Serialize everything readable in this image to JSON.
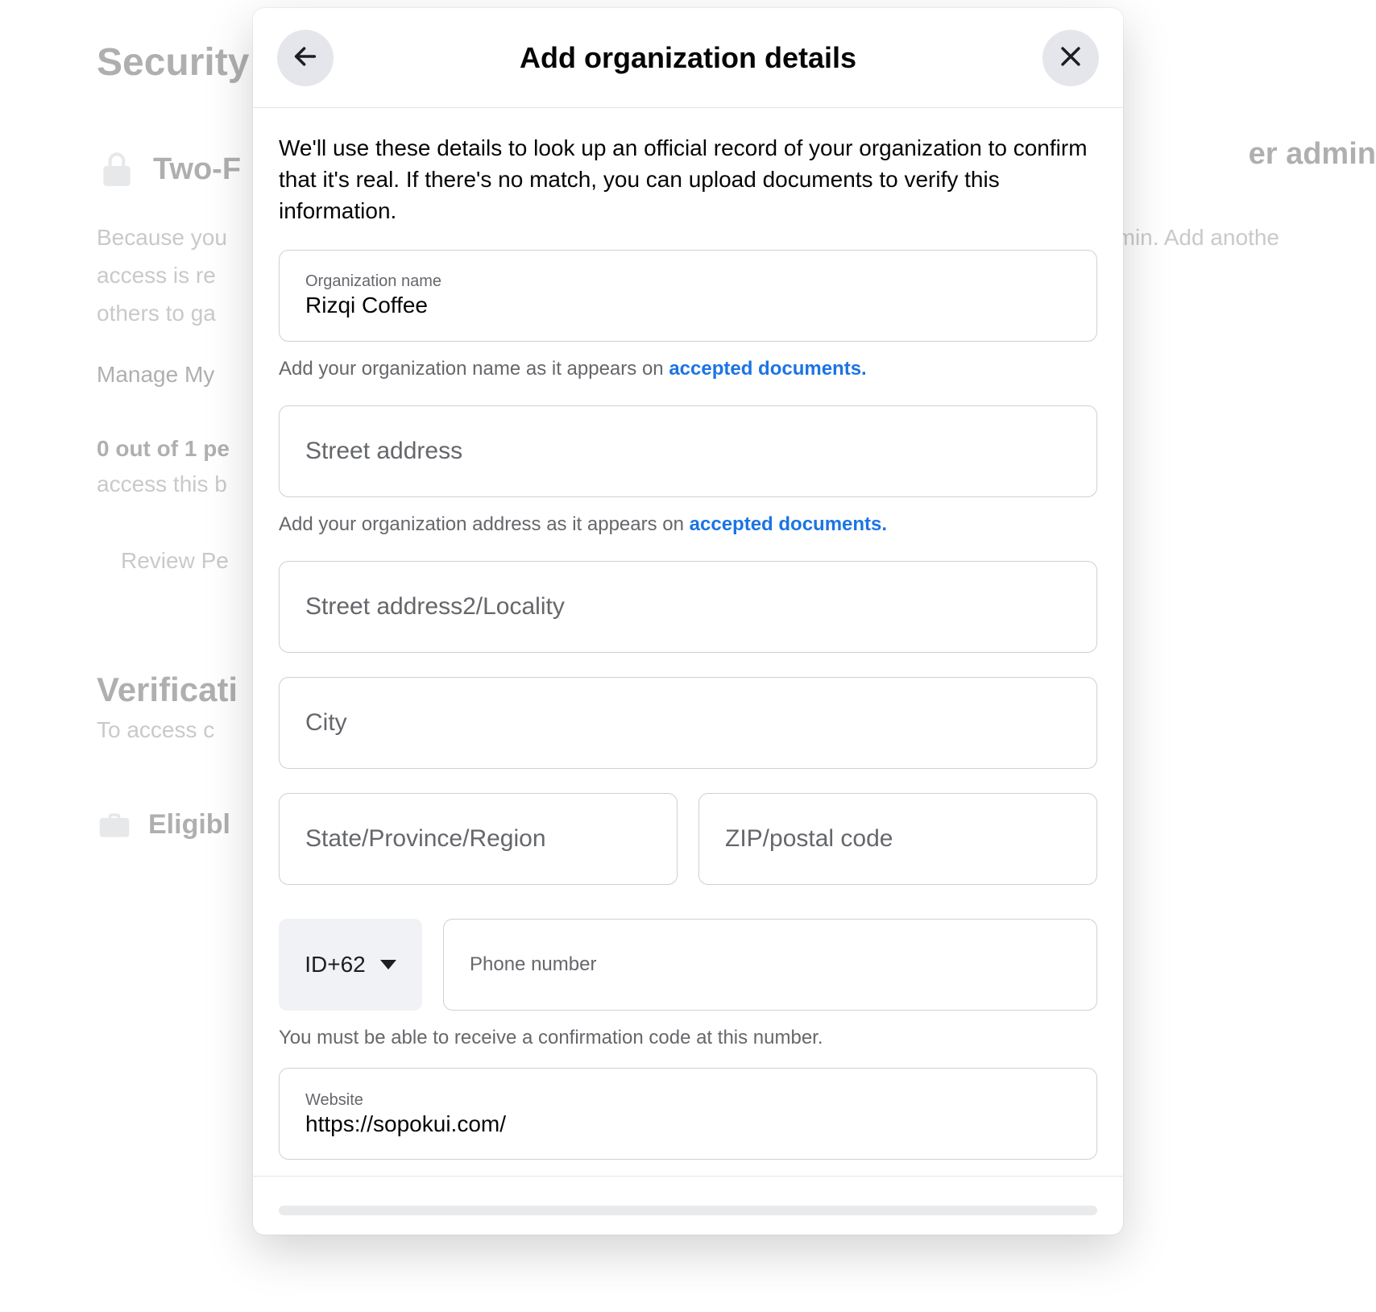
{
  "background": {
    "heading": "Security C",
    "two_factor": "Two-F",
    "right_admin": "er admin",
    "para1": "Because you",
    "para1_right": "siness admin. Add anothe",
    "para2": "access is re",
    "para3": "others to ga",
    "manage": "Manage My",
    "count": "0 out of 1 pe",
    "count2": "access this b",
    "review": "Review Pe",
    "verif": "Verificati",
    "verif_sub": "To access c",
    "eligible": "Eligibl"
  },
  "modal": {
    "title": "Add organization details",
    "intro": "We'll use these details to look up an official record of your organization to confirm that it's real. If there's no match, you can upload documents to verify this information.",
    "org_name": {
      "label": "Organization name",
      "value": "Rizqi Coffee"
    },
    "org_name_helper_pre": "Add your organization name as it appears on ",
    "org_name_helper_link": "accepted documents.",
    "street": {
      "placeholder": "Street address"
    },
    "street_helper_pre": "Add your organization address as it appears on ",
    "street_helper_link": "accepted documents.",
    "street2": {
      "placeholder": "Street address2/Locality"
    },
    "city": {
      "placeholder": "City"
    },
    "state": {
      "placeholder": "State/Province/Region"
    },
    "zip": {
      "placeholder": "ZIP/postal code"
    },
    "country_code": "ID+62",
    "phone": {
      "label": "Phone number"
    },
    "phone_helper": "You must be able to receive a confirmation code at this number.",
    "website": {
      "label": "Website",
      "value": "https://sopokui.com/"
    }
  }
}
